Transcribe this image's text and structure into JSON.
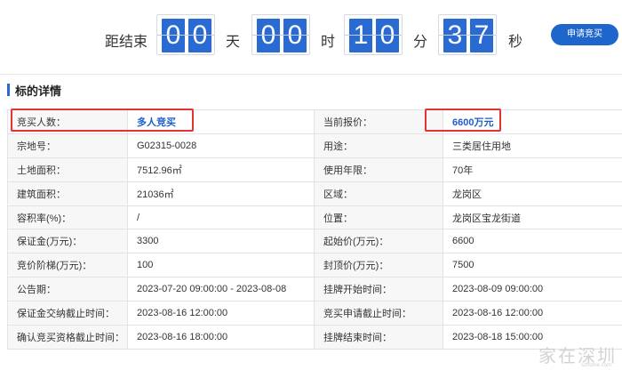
{
  "countdown": {
    "prefix": "距结束",
    "days_digits": [
      "0",
      "0"
    ],
    "days_unit": "天",
    "hours_digits": [
      "0",
      "0"
    ],
    "hours_unit": "时",
    "minutes_digits": [
      "1",
      "0"
    ],
    "minutes_unit": "分",
    "seconds_digits": [
      "3",
      "7"
    ],
    "seconds_unit": "秒"
  },
  "apply_button": "申请竞买",
  "section_title": "标的详情",
  "rows": [
    [
      {
        "label": "竞买人数："
      },
      {
        "value": "多人竞买"
      },
      {
        "label": "当前报价："
      },
      {
        "value": "6600万元"
      }
    ],
    [
      {
        "label": "宗地号："
      },
      {
        "value": "G02315-0028"
      },
      {
        "label": "用途："
      },
      {
        "value": "三类居住用地"
      }
    ],
    [
      {
        "label": "土地面积："
      },
      {
        "value": "7512.96㎡"
      },
      {
        "label": "使用年限："
      },
      {
        "value": "70年"
      }
    ],
    [
      {
        "label": "建筑面积："
      },
      {
        "value": "21036㎡"
      },
      {
        "label": "区域："
      },
      {
        "value": "龙岗区"
      }
    ],
    [
      {
        "label": "容积率(%)："
      },
      {
        "value": "/"
      },
      {
        "label": "位置："
      },
      {
        "value": "龙岗区宝龙街道"
      }
    ],
    [
      {
        "label": "保证金(万元)："
      },
      {
        "value": "3300"
      },
      {
        "label": "起始价(万元)："
      },
      {
        "value": "6600"
      }
    ],
    [
      {
        "label": "竞价阶梯(万元)："
      },
      {
        "value": "100"
      },
      {
        "label": "封顶价(万元)："
      },
      {
        "value": "7500"
      }
    ],
    [
      {
        "label": "公告期："
      },
      {
        "value": "2023-07-20 09:00:00 - 2023-08-08"
      },
      {
        "label": "挂牌开始时间："
      },
      {
        "value": "2023-08-09 09:00:00"
      }
    ],
    [
      {
        "label": "保证金交纳截止时间："
      },
      {
        "value": "2023-08-16 12:00:00"
      },
      {
        "label": "竞买申请截止时间："
      },
      {
        "value": "2023-08-16 12:00:00"
      }
    ],
    [
      {
        "label": "确认竞买资格截止时间："
      },
      {
        "value": "2023-08-16 18:00:00"
      },
      {
        "label": "挂牌结束时间："
      },
      {
        "value": "2023-08-18 15:00:00"
      }
    ]
  ],
  "watermark": "家在深圳",
  "watermark_sub": "szhome.com",
  "colors": {
    "accent": "#2a6bd3",
    "highlight": "#e53333"
  }
}
